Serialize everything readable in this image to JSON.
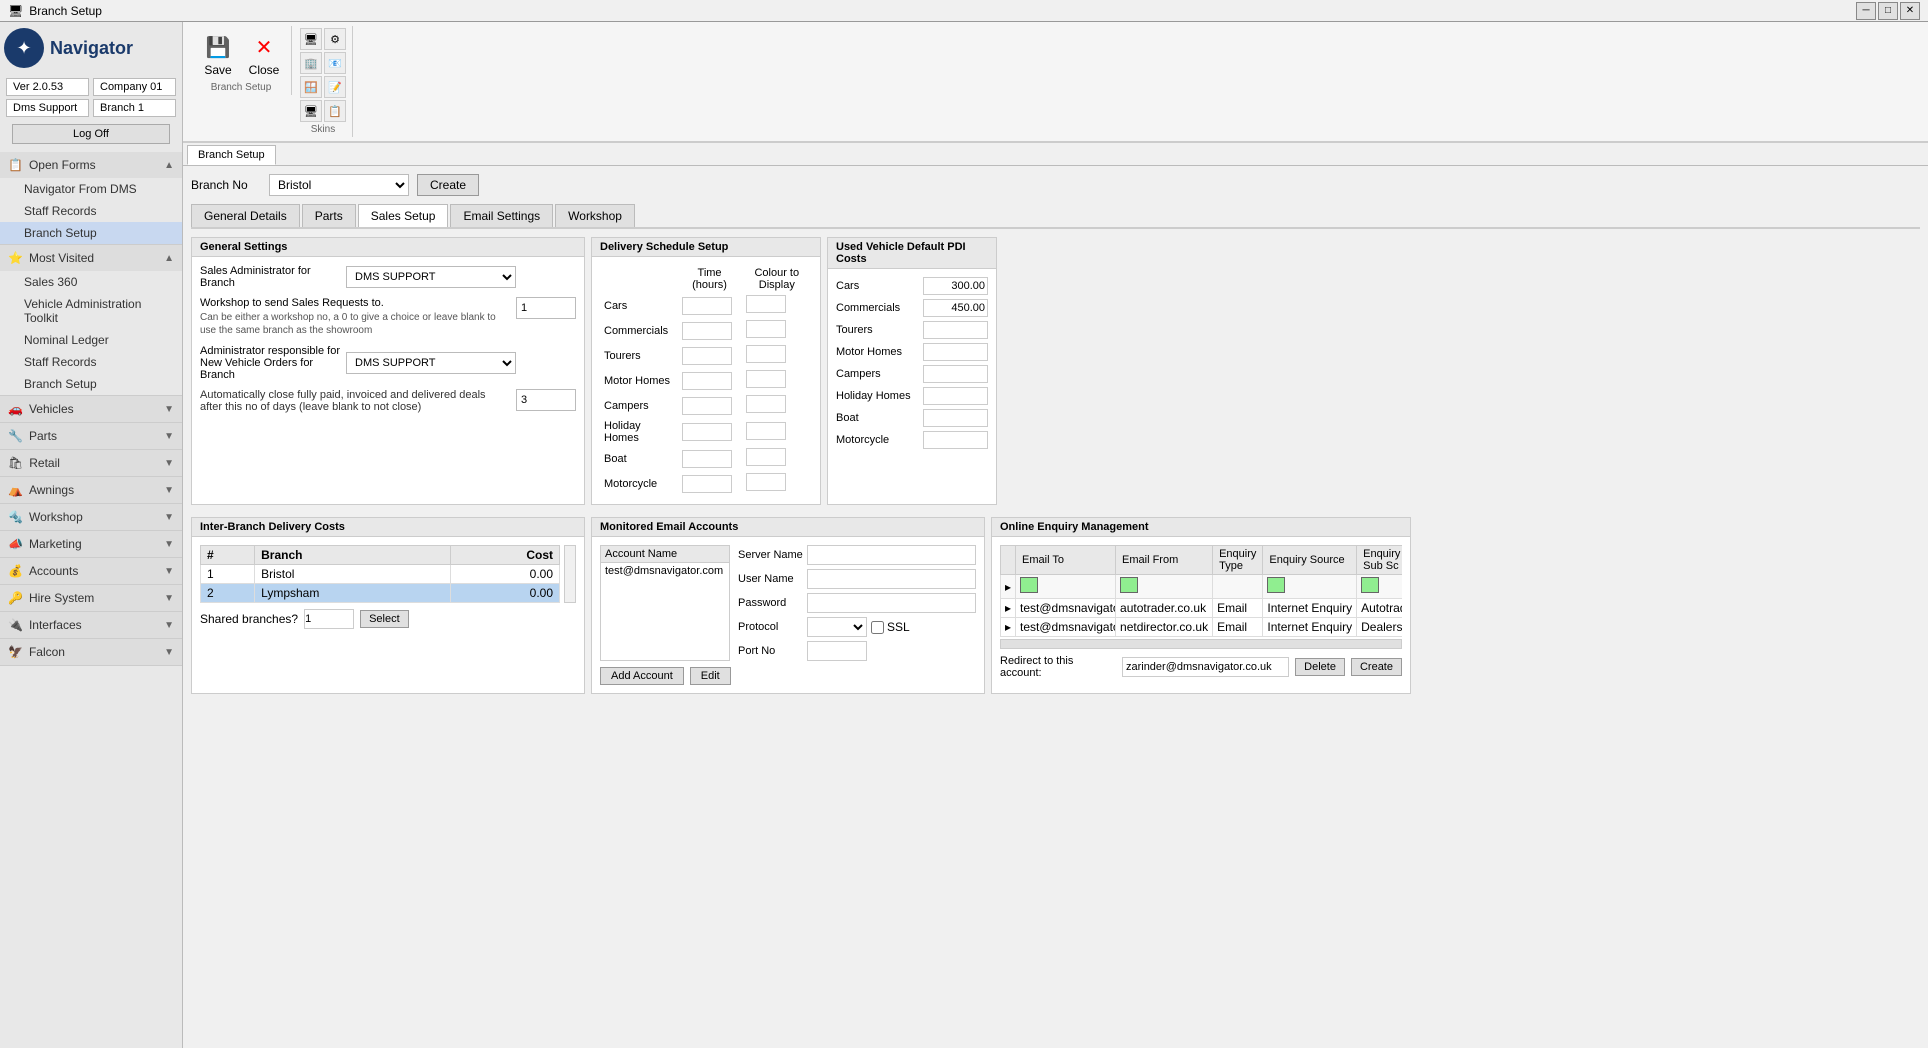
{
  "titleBar": {
    "title": "Branch Setup",
    "minBtn": "─",
    "restoreBtn": "□",
    "closeBtn": "✕"
  },
  "sidebar": {
    "logo": "Navigator",
    "version": "Ver 2.0.53",
    "company": "Company 01",
    "support": "Dms Support",
    "branch": "Branch 1",
    "logOff": "Log Off",
    "sections": [
      {
        "id": "open-forms",
        "icon": "📋",
        "label": "Open Forms",
        "expanded": true,
        "items": [
          "Navigator From DMS",
          "Staff Records",
          "Branch Setup"
        ]
      },
      {
        "id": "most-visited",
        "icon": "⭐",
        "label": "Most Visited",
        "expanded": true,
        "items": [
          "Sales 360",
          "Vehicle Administration Toolkit",
          "Nominal Ledger",
          "Staff Records",
          "Branch Setup"
        ]
      },
      {
        "id": "vehicles",
        "icon": "🚗",
        "label": "Vehicles",
        "expanded": false,
        "items": []
      },
      {
        "id": "parts",
        "icon": "🔧",
        "label": "Parts",
        "expanded": false,
        "items": []
      },
      {
        "id": "retail",
        "icon": "🛍",
        "label": "Retail",
        "expanded": false,
        "items": []
      },
      {
        "id": "awnings",
        "icon": "🏕",
        "label": "Awnings",
        "expanded": false,
        "items": []
      },
      {
        "id": "workshop",
        "icon": "🔩",
        "label": "Workshop",
        "expanded": false,
        "items": []
      },
      {
        "id": "marketing",
        "icon": "📣",
        "label": "Marketing",
        "expanded": false,
        "items": []
      },
      {
        "id": "accounts",
        "icon": "💰",
        "label": "Accounts",
        "expanded": false,
        "items": []
      },
      {
        "id": "hire-system",
        "icon": "🔑",
        "label": "Hire System",
        "expanded": false,
        "items": []
      },
      {
        "id": "interfaces",
        "icon": "🔌",
        "label": "Interfaces",
        "expanded": false,
        "items": []
      },
      {
        "id": "falcon",
        "icon": "🦅",
        "label": "Falcon",
        "expanded": false,
        "items": []
      }
    ]
  },
  "toolbar": {
    "saveLabel": "Save",
    "closeLabel": "Close",
    "branchSetupLabel": "Branch Setup",
    "skinsLabel": "Skins"
  },
  "branchTabs": [
    "Branch Setup"
  ],
  "branchNo": {
    "label": "Branch No",
    "selected": "Bristol",
    "options": [
      "Bristol",
      "Lympsham"
    ],
    "createBtn": "Create"
  },
  "innerTabs": {
    "tabs": [
      "General Details",
      "Parts",
      "Sales Setup",
      "Email Settings",
      "Workshop"
    ],
    "active": "Sales Setup"
  },
  "generalSettings": {
    "title": "General Settings",
    "salesAdminLabel": "Sales Administrator for Branch",
    "salesAdminValue": "DMS SUPPORT",
    "workshopLabel": "Workshop to send Sales Requests to.",
    "workshopHint": "Can be either a workshop no, a 0 to give a choice or leave blank to use the same branch as the showroom",
    "workshopValue": "1",
    "adminLabel": "Administrator responsible for New Vehicle Orders for Branch",
    "adminValue": "DMS SUPPORT",
    "autoCloseLabel": "Automatically close fully paid, invoiced and delivered deals after this no of days (leave blank to not close)",
    "autoCloseValue": "3"
  },
  "interBranch": {
    "title": "Inter-Branch Delivery Costs",
    "columns": [
      "#",
      "Branch",
      "Cost"
    ],
    "rows": [
      {
        "num": "1",
        "branch": "Bristol",
        "cost": "0.00",
        "selected": false
      },
      {
        "num": "2",
        "branch": "Lympsham",
        "cost": "0.00",
        "selected": true
      }
    ],
    "sharedLabel": "Shared branches?",
    "sharedValue": "1",
    "selectBtn": "Select"
  },
  "deliverySchedule": {
    "title": "Delivery Schedule Setup",
    "timeHours": "Time (hours)",
    "colourDisplay": "Colour to Display",
    "rows": [
      {
        "label": "Cars"
      },
      {
        "label": "Commercials"
      },
      {
        "label": "Tourers"
      },
      {
        "label": "Motor Homes"
      },
      {
        "label": "Campers"
      },
      {
        "label": "Holiday Homes"
      },
      {
        "label": "Boat"
      },
      {
        "label": "Motorcycle"
      }
    ]
  },
  "pdiCosts": {
    "title": "Used Vehicle Default PDI Costs",
    "rows": [
      {
        "label": "Cars",
        "value": "300.00"
      },
      {
        "label": "Commercials",
        "value": "450.00"
      },
      {
        "label": "Tourers",
        "value": ""
      },
      {
        "label": "Motor Homes",
        "value": ""
      },
      {
        "label": "Campers",
        "value": ""
      },
      {
        "label": "Holiday Homes",
        "value": ""
      },
      {
        "label": "Boat",
        "value": ""
      },
      {
        "label": "Motorcycle",
        "value": ""
      }
    ]
  },
  "monitoredEmail": {
    "title": "Monitored Email Accounts",
    "accountNameHeader": "Account Name",
    "accountItem": "test@dmsnavigator.com",
    "serverNameLabel": "Server Name",
    "userNameLabel": "User Name",
    "passwordLabel": "Password",
    "protocolLabel": "Protocol",
    "portNoLabel": "Port No",
    "sslLabel": "SSL",
    "addAccountBtn": "Add Account",
    "editBtn": "Edit"
  },
  "onlineEnquiry": {
    "title": "Online Enquiry Management",
    "columns": [
      "Email To",
      "Email From",
      "Enquiry Type",
      "Enquiry Source",
      "Enquiry Sub Sc"
    ],
    "rows": [
      {
        "emailTo": "test@dmsnavigator.com",
        "emailFrom": "autotrader.co.uk",
        "enquiryType": "Email",
        "enquirySource": "Internet Enquiry",
        "enquirySubSc": "Autotrader"
      },
      {
        "emailTo": "test@dmsnavigator.com",
        "emailFrom": "netdirector.co.uk",
        "enquiryType": "Email",
        "enquirySource": "Internet Enquiry",
        "enquirySubSc": "Dealership"
      }
    ],
    "redirectLabel": "Redirect to this account:",
    "redirectValue": "zarinder@dmsnavigator.co.uk",
    "deleteBtn": "Delete",
    "createBtn": "Create"
  }
}
